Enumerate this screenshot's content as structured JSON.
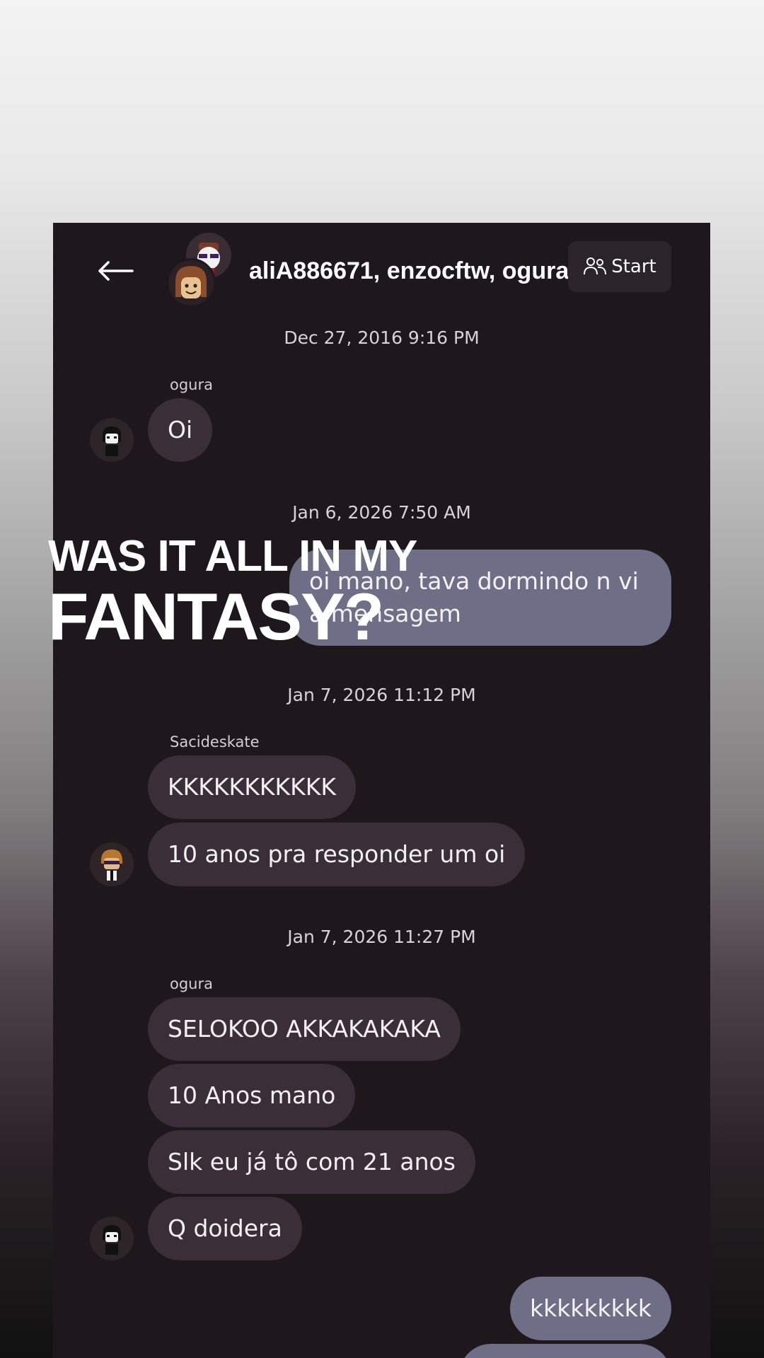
{
  "header": {
    "title": "aliA886671, enzocftw, ogura...",
    "start_label": "Start",
    "icons": [
      "back-arrow-icon",
      "group-avatar",
      "people-icon"
    ]
  },
  "overlay_caption": {
    "line1": "WAS IT ALL IN MY",
    "line2": "FANTASY?"
  },
  "groups": [
    {
      "timestamp": "Dec 27, 2016 9:16 PM",
      "sender": "ogura",
      "messages": [
        "Oi"
      ]
    },
    {
      "timestamp": "Jan 6, 2026 7:50 AM",
      "outgoing": [
        "oi mano, tava dormindo n vi a mensagem"
      ]
    },
    {
      "timestamp": "Jan 7, 2026 11:12 PM",
      "sender": "Sacideskate",
      "messages": [
        "KKKKKKKKKKK",
        "10 anos pra responder um oi"
      ]
    },
    {
      "timestamp": "Jan 7, 2026 11:27 PM",
      "sender": "ogura",
      "messages": [
        "SELOKOO AKKAKAKAKA",
        "10 Anos mano",
        "Slk eu já tô com 21 anos",
        "Q doidera"
      ],
      "outgoing": [
        "kkkkkkkkk"
      ]
    }
  ],
  "colors": {
    "chat_bg": "#1e171c",
    "incoming_bubble": "#3a2e39",
    "outgoing_bubble": "#6f6e87"
  }
}
